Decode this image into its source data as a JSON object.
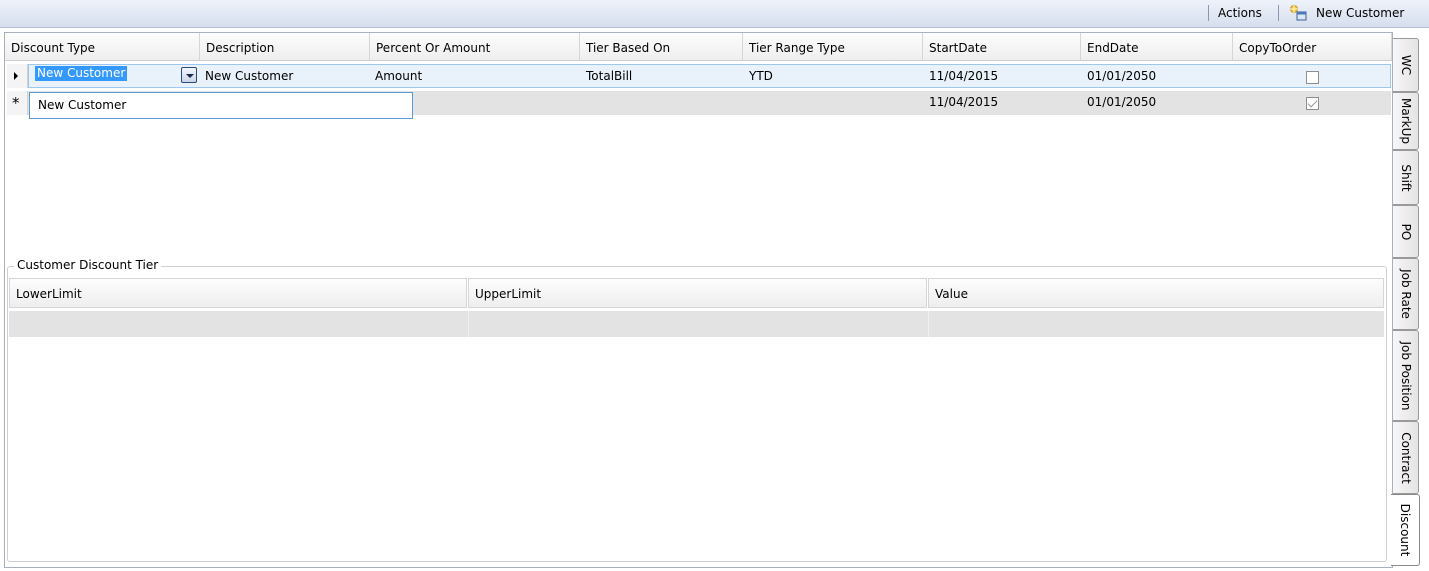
{
  "toolbar": {
    "actions_label": "Actions",
    "new_customer_label": "New Customer",
    "new_customer_icon": "new-customer-icon"
  },
  "grid": {
    "columns": [
      "Discount Type",
      "Description",
      "Percent Or Amount",
      "Tier Based On",
      "Tier Range Type",
      "StartDate",
      "EndDate",
      "CopyToOrder"
    ],
    "rows": [
      {
        "discount_type": "New Customer",
        "description": "New Customer",
        "percent_or_amount": "Amount",
        "tier_based_on": "TotalBill",
        "tier_range_type": "YTD",
        "start_date": "11/04/2015",
        "end_date": "01/01/2050",
        "copy_to_order": false
      },
      {
        "discount_type": "",
        "description": "",
        "percent_or_amount": "",
        "tier_based_on": "",
        "tier_range_type": "",
        "start_date": "11/04/2015",
        "end_date": "01/01/2050",
        "copy_to_order": true
      }
    ],
    "new_row_marker": "*",
    "dropdown_options": [
      "New Customer"
    ]
  },
  "tier": {
    "title": "Customer Discount Tier",
    "columns": [
      "LowerLimit",
      "UpperLimit",
      "Value"
    ]
  },
  "side_tabs": [
    "WC",
    "MarkUp",
    "Shift",
    "PO",
    "Job Rate",
    "Job Position",
    "Contract",
    "Discount"
  ],
  "active_tab": "Discount",
  "colors": {
    "selection": "#3399ff",
    "selected_row_bg": "#e9f2fb",
    "selected_row_border": "#9cc8ef",
    "new_row_bg": "#e3e3e3"
  }
}
